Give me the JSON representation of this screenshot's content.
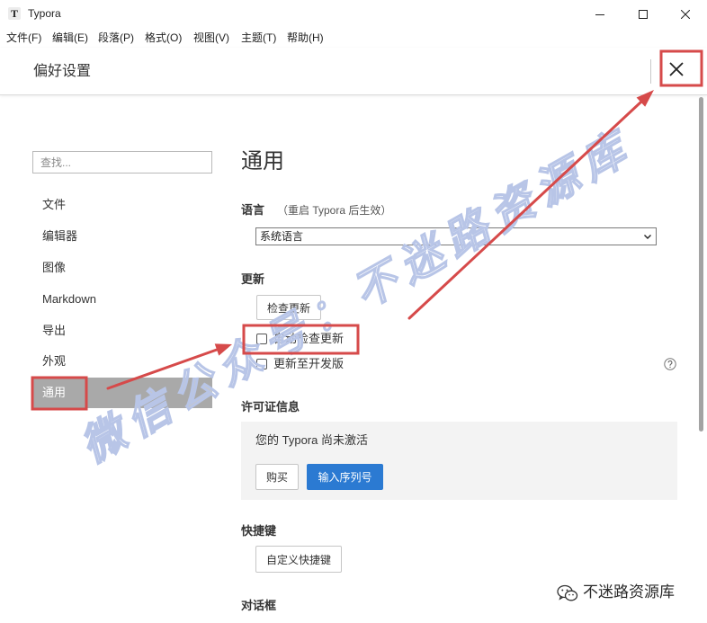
{
  "window": {
    "app_icon_glyph": "T",
    "title": "Typora",
    "controls": [
      "minimize-icon",
      "maximize-icon",
      "close-icon"
    ]
  },
  "menu": {
    "items": [
      "文件(F)",
      "编辑(E)",
      "段落(P)",
      "格式(O)",
      "视图(V)",
      "主题(T)",
      "帮助(H)"
    ]
  },
  "header": {
    "title": "偏好设置",
    "close_icon": "close-icon"
  },
  "sidebar": {
    "search_placeholder": "查找...",
    "items": [
      {
        "label": "文件",
        "selected": false
      },
      {
        "label": "编辑器",
        "selected": false
      },
      {
        "label": "图像",
        "selected": false
      },
      {
        "label": "Markdown",
        "selected": false
      },
      {
        "label": "导出",
        "selected": false
      },
      {
        "label": "外观",
        "selected": false
      },
      {
        "label": "通用",
        "selected": true
      }
    ]
  },
  "main": {
    "heading": "通用",
    "language": {
      "label": "语言",
      "hint": "（重启 Typora 后生效）",
      "selected_option": "系统语言"
    },
    "update": {
      "label": "更新",
      "check_button": "检查更新",
      "options": [
        {
          "label": "自动检查更新",
          "checked": false
        },
        {
          "label": "更新至开发版",
          "checked": false
        }
      ],
      "help_icon": "help-icon"
    },
    "license": {
      "label": "许可证信息",
      "status": "您的 Typora 尚未激活",
      "buy_button": "购买",
      "serial_button": "输入序列号"
    },
    "shortcuts": {
      "label": "快捷键",
      "button": "自定义快捷键"
    },
    "dialogs": {
      "label": "对话框"
    }
  },
  "watermark": {
    "text": "微信公众号：不迷路资源库"
  },
  "signature": {
    "icon": "wechat-icon",
    "text": "不迷路资源库"
  },
  "colors": {
    "accent": "#2b7ad2",
    "selected_nav": "#a9a9a9",
    "annotation": "#d64a4a",
    "watermark": "#b8c5e7",
    "license_panel": "#f3f3f3"
  }
}
